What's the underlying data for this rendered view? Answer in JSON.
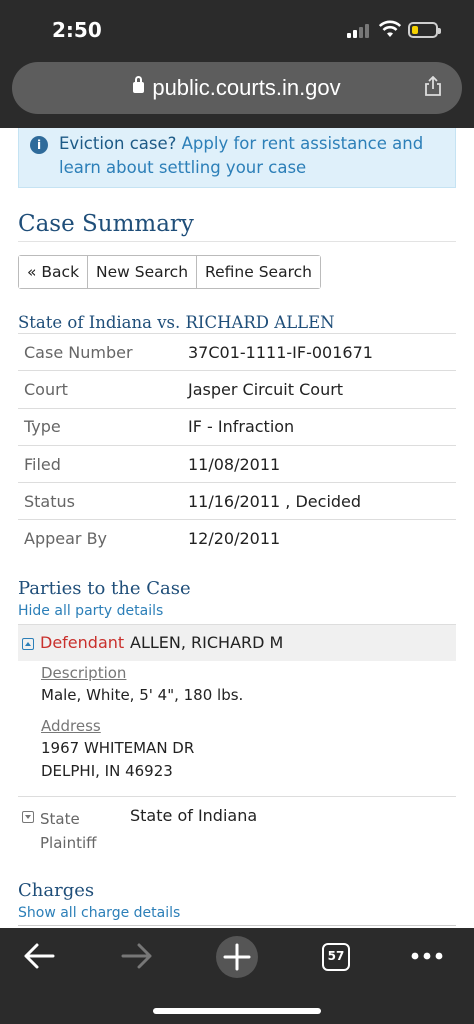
{
  "status_bar": {
    "time": "2:50"
  },
  "browser": {
    "url": "public.courts.in.gov",
    "tab_count": "57"
  },
  "banner": {
    "lead": "Eviction case?",
    "link_text": "Apply for rent assistance and learn about settling your case"
  },
  "page_title": "Case Summary",
  "buttons": {
    "back": "« Back",
    "new_search": "New Search",
    "refine_search": "Refine Search"
  },
  "case_title": "State of Indiana vs. RICHARD ALLEN",
  "case_info": [
    {
      "label": "Case Number",
      "value": "37C01-1111-IF-001671"
    },
    {
      "label": "Court",
      "value": "Jasper Circuit Court"
    },
    {
      "label": "Type",
      "value": "IF - Infraction"
    },
    {
      "label": "Filed",
      "value": "11/08/2011"
    },
    {
      "label": "Status",
      "value": "11/16/2011 , Decided"
    },
    {
      "label": "Appear By",
      "value": "12/20/2011"
    }
  ],
  "parties": {
    "heading": "Parties to the Case",
    "hide_link": "Hide all party details",
    "defendant": {
      "role": "Defendant",
      "name": "ALLEN, RICHARD M",
      "description_label": "Description",
      "description": "Male, White, 5' 4\", 180 lbs.",
      "address_label": "Address",
      "address_line1": "1967 WHITEMAN DR",
      "address_line2": "DELPHI, IN 46923"
    },
    "plaintiff": {
      "role_line1": "State",
      "role_line2": "Plaintiff",
      "name": "State of Indiana"
    }
  },
  "charges": {
    "heading": "Charges",
    "show_link": "Show all charge details"
  },
  "colors": {
    "heading": "#1f4e79",
    "link": "#2c7fb8",
    "defendant": "#c9302c",
    "banner_bg": "#dff0fa",
    "chrome": "#2b2b2b"
  }
}
